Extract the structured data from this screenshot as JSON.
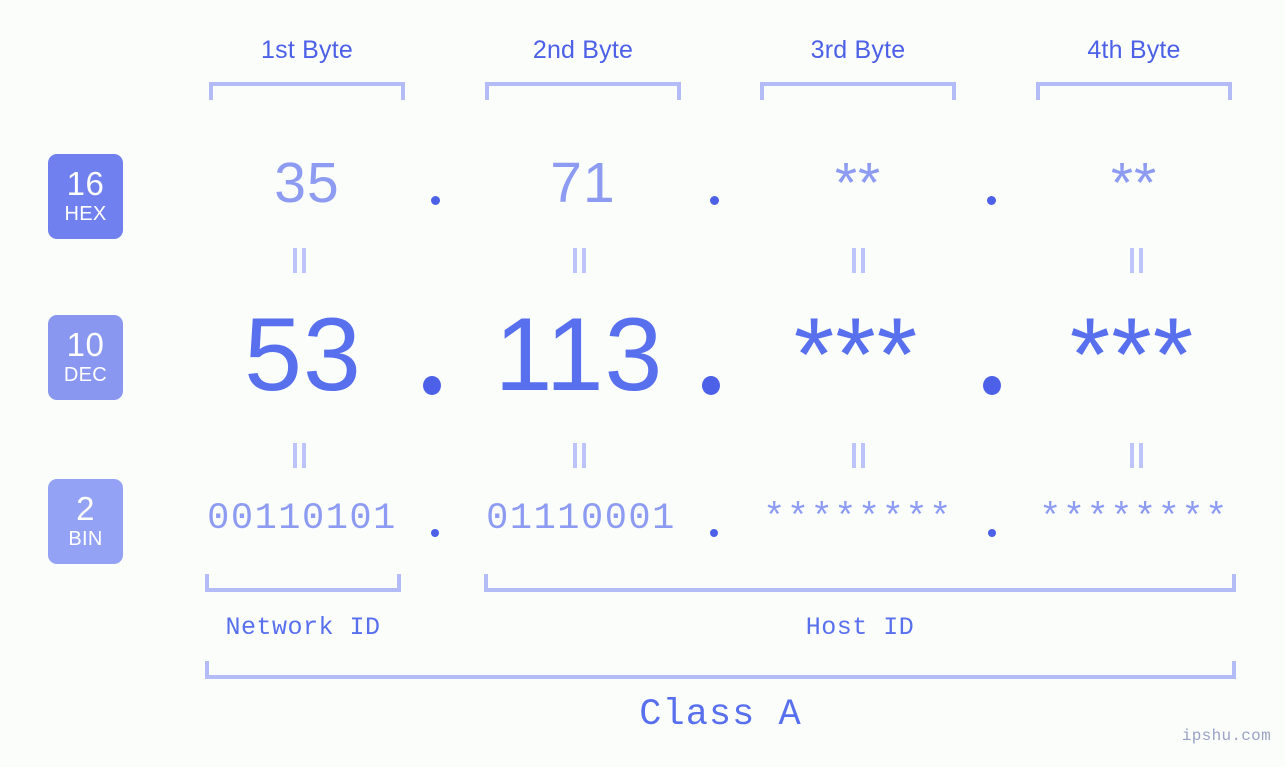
{
  "meta": {
    "background_color": "#fbfdfa",
    "accent_color": "#5970ee",
    "light_accent_color": "#b4bcf8",
    "muted_value_color": "#8d9bf2",
    "watermark": "ipshu.com"
  },
  "byte_headers": [
    {
      "label": "1st Byte"
    },
    {
      "label": "2nd Byte"
    },
    {
      "label": "3rd Byte"
    },
    {
      "label": "4th Byte"
    }
  ],
  "bases": [
    {
      "number": "16",
      "name": "HEX",
      "color": "#7080ee"
    },
    {
      "number": "10",
      "name": "DEC",
      "color": "#8a97f0"
    },
    {
      "number": "2",
      "name": "BIN",
      "color": "#93a2f5"
    }
  ],
  "rows": {
    "hex": {
      "base_number": "16",
      "base_name": "HEX",
      "values": [
        "35",
        "71",
        "**",
        "**"
      ],
      "separator": "."
    },
    "dec": {
      "base_number": "10",
      "base_name": "DEC",
      "values": [
        "53",
        "113",
        "***",
        "***"
      ],
      "separator": "."
    },
    "bin": {
      "base_number": "2",
      "base_name": "BIN",
      "values": [
        "00110101",
        "01110001",
        "********",
        "********"
      ],
      "separator": "."
    }
  },
  "equals_marks": {
    "glyph": "=",
    "count_per_row": 4
  },
  "segments": {
    "network_id": {
      "label": "Network ID"
    },
    "host_id": {
      "label": "Host ID"
    },
    "class": {
      "label": "Class A"
    }
  }
}
